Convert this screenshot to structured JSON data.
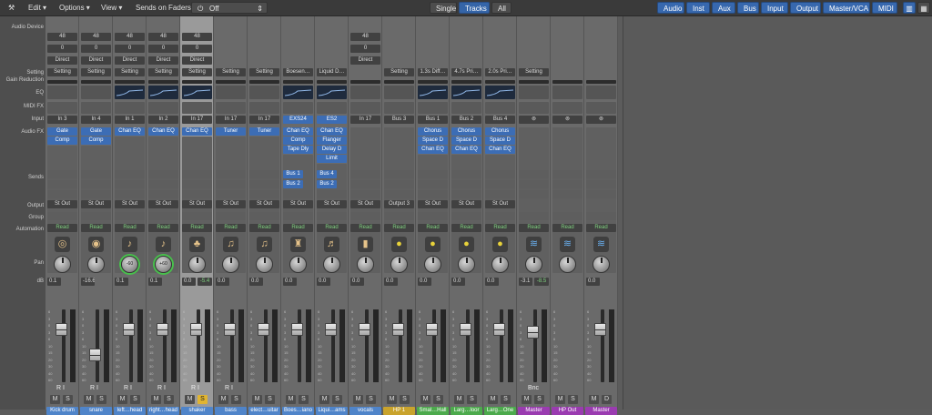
{
  "toolbar": {
    "tool_icon": "wrench-icon",
    "menus": [
      "Edit",
      "Options",
      "View"
    ],
    "sends_on_faders_label": "Sends on Faders:",
    "sends_on_faders_value": "Off",
    "view_modes": [
      "Single",
      "Tracks",
      "All"
    ],
    "view_selected": "Tracks",
    "filters": [
      "Audio",
      "Inst",
      "Aux",
      "Bus",
      "Input",
      "Output",
      "Master/VCA",
      "MIDI"
    ],
    "layout_icons": [
      "strip-view-icon",
      "grid-view-icon"
    ]
  },
  "row_labels": {
    "audio_device": "Audio Device",
    "setting": "Setting",
    "gain_reduction": "Gain Reduction",
    "eq": "EQ",
    "midi_fx": "MIDI FX",
    "input": "Input",
    "audio_fx": "Audio FX",
    "sends": "Sends",
    "output": "Output",
    "group": "Group",
    "automation": "Automation",
    "pan": "Pan",
    "db": "dB"
  },
  "fader_scale": [
    "6",
    "3",
    "0",
    "3",
    "6",
    "10",
    "15",
    "20",
    "30",
    "40",
    "60"
  ],
  "strips": [
    {
      "name": "Kick drum",
      "device": "48",
      "zero": "0",
      "direct": "Direct",
      "setting": "Setting",
      "eq": false,
      "input": "In 3",
      "fx": [
        "Gate",
        "Comp"
      ],
      "sends": [],
      "output": "St Out",
      "automation": "Read",
      "icon": "cymbal-icon",
      "glyph": "◎",
      "pan": "",
      "pan_green": false,
      "db_a": "0.1",
      "db_b": "",
      "name_color": "#4f84c9",
      "solo": false,
      "ri": "R I",
      "fader": 0.78
    },
    {
      "name": "snare",
      "device": "48",
      "zero": "0",
      "direct": "Direct",
      "setting": "Setting",
      "eq": false,
      "input": "In 4",
      "fx": [
        "Gate",
        "Comp"
      ],
      "sends": [],
      "output": "St Out",
      "automation": "Read",
      "icon": "snare-drum-icon",
      "glyph": "◉",
      "pan": "",
      "pan_green": false,
      "db_a": "-16.6",
      "db_b": "",
      "name_color": "#4f84c9",
      "solo": false,
      "ri": "R I",
      "fader": 0.35
    },
    {
      "name": "left…head",
      "device": "48",
      "zero": "0",
      "direct": "Direct",
      "setting": "Setting",
      "eq": true,
      "input": "In 1",
      "fx": [
        "Chan EQ"
      ],
      "sends": [],
      "output": "St Out",
      "automation": "Read",
      "icon": "microphone-icon",
      "glyph": "♪",
      "pan": "-60",
      "pan_green": true,
      "db_a": "0.1",
      "db_b": "",
      "name_color": "#4f84c9",
      "solo": false,
      "ri": "R I",
      "fader": 0.78
    },
    {
      "name": "right…head",
      "device": "48",
      "zero": "0",
      "direct": "Direct",
      "setting": "Setting",
      "eq": true,
      "input": "In 2",
      "fx": [
        "Chan EQ"
      ],
      "sends": [],
      "output": "St Out",
      "automation": "Read",
      "icon": "microphone-icon",
      "glyph": "♪",
      "pan": "+60",
      "pan_green": true,
      "db_a": "0.1",
      "db_b": "",
      "name_color": "#4f84c9",
      "solo": false,
      "ri": "R I",
      "fader": 0.78
    },
    {
      "name": "shaker",
      "device": "48",
      "zero": "0",
      "direct": "Direct",
      "setting": "Setting",
      "eq": true,
      "input": "In 17",
      "fx": [
        "Chan EQ"
      ],
      "sends": [],
      "output": "St Out",
      "automation": "Read",
      "icon": "maraca-icon",
      "glyph": "♣",
      "pan": "",
      "pan_green": false,
      "db_a": "0.0",
      "db_b": "-5.4",
      "name_color": "#4f84c9",
      "solo": true,
      "ri": "R I",
      "fader": 0.78,
      "selected": true
    },
    {
      "name": "bass",
      "device": "",
      "zero": "",
      "direct": "",
      "setting": "Setting",
      "eq": false,
      "input": "In 17",
      "fx": [
        "Tuner"
      ],
      "sends": [],
      "output": "St Out",
      "automation": "Read",
      "icon": "bass-guitar-icon",
      "glyph": "♫",
      "pan": "",
      "pan_green": false,
      "db_a": "0.0",
      "db_b": "",
      "name_color": "#4f84c9",
      "solo": false,
      "ri": "R I",
      "fader": 0.78
    },
    {
      "name": "elect…uitar",
      "device": "",
      "zero": "",
      "direct": "",
      "setting": "Setting",
      "eq": false,
      "input": "In 17",
      "fx": [
        "Tuner"
      ],
      "sends": [],
      "output": "St Out",
      "automation": "Read",
      "icon": "electric-guitar-icon",
      "glyph": "♫",
      "pan": "",
      "pan_green": false,
      "db_a": "0.0",
      "db_b": "",
      "name_color": "#4f84c9",
      "solo": false,
      "ri": "",
      "fader": 0.78
    },
    {
      "name": "Boes…iano",
      "device": "",
      "zero": "",
      "direct": "",
      "setting": "Boesen…",
      "eq": true,
      "input": "EXS24",
      "fx": [
        "Chan EQ",
        "Comp",
        "Tape Dly"
      ],
      "sends": [
        "Bus 1",
        "Bus 2"
      ],
      "output": "St Out",
      "automation": "Read",
      "icon": "piano-icon",
      "glyph": "♜",
      "pan": "",
      "pan_green": false,
      "db_a": "0.0",
      "db_b": "",
      "name_color": "#4f84c9",
      "solo": false,
      "ri": "",
      "fader": 0.78,
      "input_blue": true
    },
    {
      "name": "Liqui…ams",
      "device": "",
      "zero": "",
      "direct": "",
      "setting": "Liquid D…",
      "eq": true,
      "input": "ES2",
      "fx": [
        "Chan EQ",
        "Flanger",
        "Delay D",
        "Limit"
      ],
      "sends": [
        "Bus 4",
        "Bus 2"
      ],
      "output": "St Out",
      "automation": "Read",
      "icon": "drum-kit-icon",
      "glyph": "♬",
      "pan": "",
      "pan_green": false,
      "db_a": "0.0",
      "db_b": "",
      "name_color": "#4f84c9",
      "solo": false,
      "ri": "",
      "fader": 0.78,
      "input_blue": true
    },
    {
      "name": "vocals",
      "device": "48",
      "zero": "0",
      "direct": "Direct",
      "setting": "",
      "eq": false,
      "input": "In 17",
      "fx": [],
      "sends": [],
      "output": "St Out",
      "automation": "Read",
      "icon": "microphone-icon",
      "glyph": "▮",
      "pan": "",
      "pan_green": false,
      "db_a": "0.0",
      "db_b": "",
      "name_color": "#4f84c9",
      "solo": false,
      "ri": "",
      "fader": 0.78
    },
    {
      "name": "HP 1",
      "device": "",
      "zero": "",
      "direct": "",
      "setting": "Setting",
      "eq": false,
      "input": "Bus 3",
      "fx": [],
      "sends": [],
      "output": "Output 3",
      "automation": "Read",
      "icon": "aux-knob-icon",
      "glyph": "●",
      "pan": "",
      "pan_green": false,
      "db_a": "0.0",
      "db_b": "",
      "name_color": "#c9a32c",
      "solo": false,
      "ri": "",
      "fader": 0.78
    },
    {
      "name": "Smal…Hall",
      "device": "",
      "zero": "",
      "direct": "",
      "setting": "1.3s Diff…",
      "eq": true,
      "input": "Bus 1",
      "fx": [
        "Chorus",
        "Space D",
        "Chan EQ"
      ],
      "sends": [],
      "output": "St Out",
      "automation": "Read",
      "icon": "aux-knob-icon",
      "glyph": "●",
      "pan": "",
      "pan_green": false,
      "db_a": "0.0",
      "db_b": "",
      "name_color": "#4caa4c",
      "solo": false,
      "ri": "",
      "fader": 0.78
    },
    {
      "name": "Larg…loor",
      "device": "",
      "zero": "",
      "direct": "",
      "setting": "4.7s Pri…",
      "eq": true,
      "input": "Bus 2",
      "fx": [
        "Chorus",
        "Space D",
        "Chan EQ"
      ],
      "sends": [],
      "output": "St Out",
      "automation": "Read",
      "icon": "aux-knob-icon",
      "glyph": "●",
      "pan": "",
      "pan_green": false,
      "db_a": "0.0",
      "db_b": "",
      "name_color": "#4caa4c",
      "solo": false,
      "ri": "",
      "fader": 0.78
    },
    {
      "name": "Larg…One",
      "device": "",
      "zero": "",
      "direct": "",
      "setting": "2.0s Pri…",
      "eq": true,
      "input": "Bus 4",
      "fx": [
        "Chorus",
        "Space D",
        "Chan EQ"
      ],
      "sends": [],
      "output": "St Out",
      "automation": "Read",
      "icon": "aux-knob-icon",
      "glyph": "●",
      "pan": "",
      "pan_green": false,
      "db_a": "0.0",
      "db_b": "",
      "name_color": "#4caa4c",
      "solo": false,
      "ri": "",
      "fader": 0.78
    },
    {
      "name": "Master",
      "device": "",
      "zero": "",
      "direct": "",
      "setting": "Setting",
      "eq": false,
      "input": "",
      "fx": [],
      "sends": [],
      "output": "",
      "automation": "Read",
      "icon": "waveform-icon",
      "glyph": "≋",
      "pan": "",
      "pan_green": false,
      "db_a": "-3.1",
      "db_b": "-8.5",
      "name_color": "#9a3bb0",
      "solo": false,
      "ri": "Bnc",
      "fader": 0.72
    },
    {
      "name": "HP Out",
      "device": "",
      "zero": "",
      "direct": "",
      "setting": "",
      "eq": false,
      "input": "",
      "fx": [],
      "sends": [],
      "output": "",
      "automation": "Read",
      "icon": "waveform-icon",
      "glyph": "≋",
      "pan": "",
      "pan_green": false,
      "db_a": "",
      "db_b": "",
      "name_color": "#9a3bb0",
      "solo": false,
      "ri": "",
      "fader": -1
    },
    {
      "name": "Master",
      "device": "",
      "zero": "",
      "direct": "",
      "setting": "",
      "eq": false,
      "input": "",
      "fx": [],
      "sends": [],
      "output": "",
      "automation": "Read",
      "icon": "waveform-icon",
      "glyph": "≋",
      "pan": "",
      "pan_green": false,
      "db_a": "0.0",
      "db_b": "",
      "name_color": "#9a3bb0",
      "solo": false,
      "ri": "",
      "fader": 0.78,
      "md": true
    }
  ]
}
